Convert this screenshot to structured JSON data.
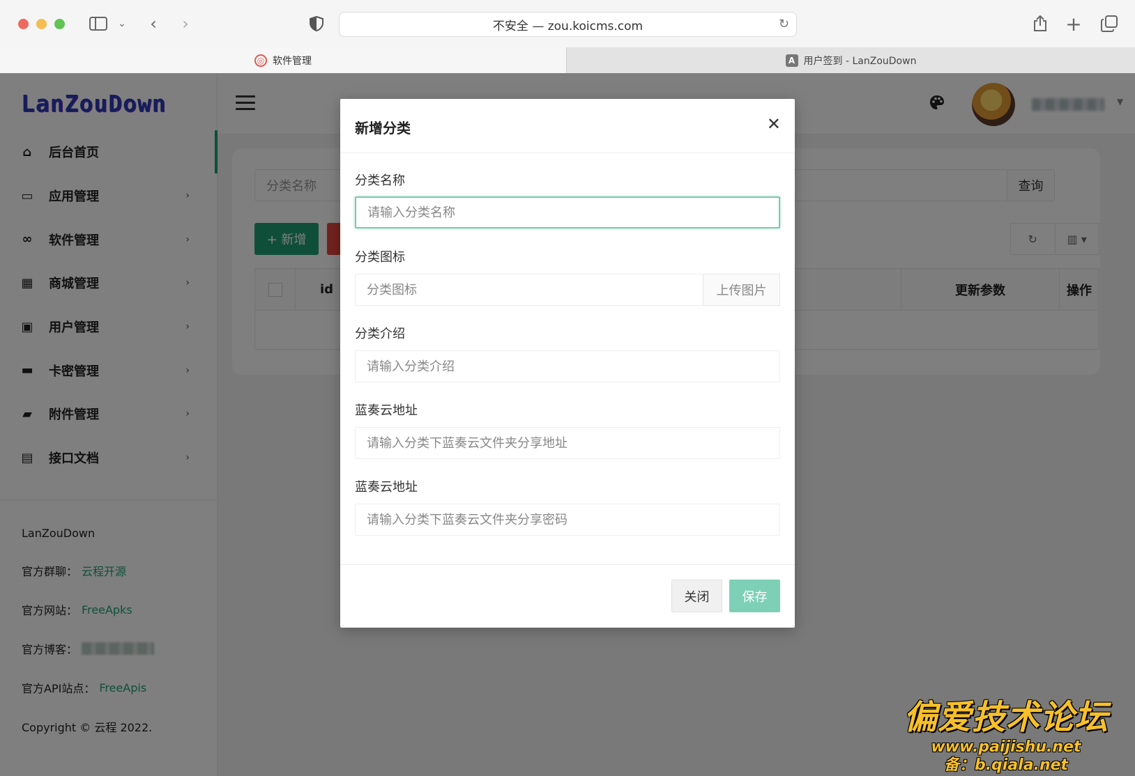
{
  "browser": {
    "url": "不安全 — zou.koicms.com",
    "tabs": [
      {
        "label": "软件管理"
      },
      {
        "label": "用户签到 - LanZouDown",
        "favicon": "A"
      }
    ]
  },
  "app": {
    "logo": "LanZouDown",
    "sidebar": {
      "items": [
        {
          "label": "后台首页",
          "icon": "home-icon"
        },
        {
          "label": "应用管理",
          "icon": "monitor-icon"
        },
        {
          "label": "软件管理",
          "icon": "infinity-icon"
        },
        {
          "label": "商城管理",
          "icon": "store-icon"
        },
        {
          "label": "用户管理",
          "icon": "user-badge-icon"
        },
        {
          "label": "卡密管理",
          "icon": "card-icon"
        },
        {
          "label": "附件管理",
          "icon": "folder-icon"
        },
        {
          "label": "接口文档",
          "icon": "inbox-icon"
        }
      ],
      "footer": {
        "title": "LanZouDown",
        "group_label": "官方群聊：",
        "group_value": "云程开源",
        "site_label": "官方网站：",
        "site_value": "FreeApks",
        "blog_label": "官方博客：",
        "api_label": "官方API站点：",
        "api_value": "FreeApis",
        "copyright": "Copyright © 云程 2022."
      }
    },
    "content": {
      "search_placeholder": "分类名称",
      "query_label": "查询",
      "add_label": "+ 新增",
      "columns": {
        "id": "id",
        "update": "更新参数",
        "op": "操作"
      }
    }
  },
  "modal": {
    "title": "新增分类",
    "fields": [
      {
        "label": "分类名称",
        "placeholder": "请输入分类名称"
      },
      {
        "label": "分类图标",
        "placeholder": "分类图标",
        "button": "上传图片"
      },
      {
        "label": "分类介绍",
        "placeholder": "请输入分类介绍"
      },
      {
        "label": "蓝奏云地址",
        "placeholder": "请输入分类下蓝奏云文件夹分享地址"
      },
      {
        "label": "蓝奏云地址",
        "placeholder": "请输入分类下蓝奏云文件夹分享密码"
      }
    ],
    "close_label": "关闭",
    "save_label": "保存"
  },
  "watermark": {
    "title": "偏爱技术论坛",
    "line1": "www.paijishu.net",
    "line2": "备：b.qiala.net"
  },
  "colors": {
    "accent": "#1e9f74",
    "danger": "#e2453c"
  }
}
